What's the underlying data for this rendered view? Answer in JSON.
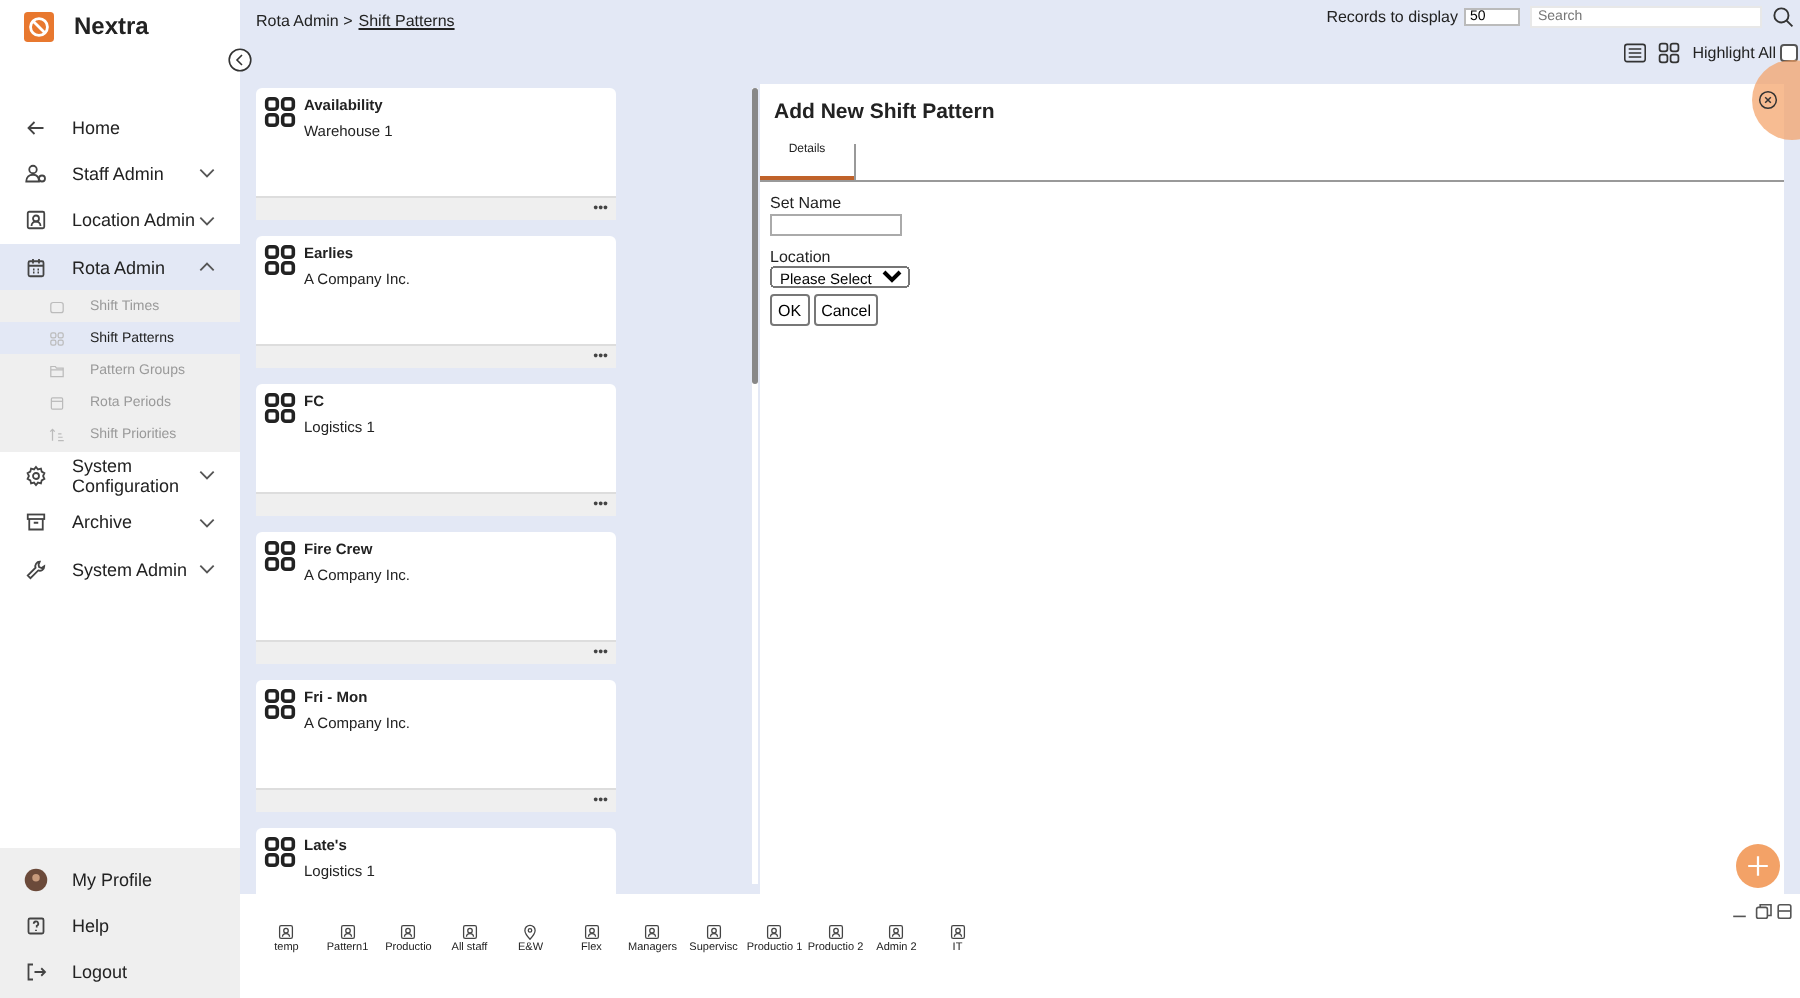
{
  "brand": {
    "name": "Nextra"
  },
  "sidebar": {
    "items": [
      {
        "label": "Home",
        "selected": false
      },
      {
        "label": "Staff Admin",
        "expanded": false,
        "selected": false
      },
      {
        "label": "Location Admin",
        "expanded": false,
        "selected": false
      },
      {
        "label": "Rota Admin",
        "expanded": true,
        "selected": true,
        "children": [
          {
            "label": "Shift Times",
            "selected": false
          },
          {
            "label": "Shift Patterns",
            "selected": true
          },
          {
            "label": "Pattern Groups",
            "selected": false
          },
          {
            "label": "Rota Periods",
            "selected": false
          },
          {
            "label": "Shift Priorities",
            "selected": false
          }
        ]
      },
      {
        "label": "System Configuration",
        "expanded": false,
        "selected": false
      },
      {
        "label": "Archive",
        "expanded": false,
        "selected": false
      },
      {
        "label": "System Admin",
        "expanded": false,
        "selected": false
      }
    ],
    "footer": [
      {
        "label": "My Profile"
      },
      {
        "label": "Help"
      },
      {
        "label": "Logout"
      }
    ]
  },
  "breadcrumb": {
    "parent": "Rota Admin >",
    "current": "Shift Patterns"
  },
  "toolbar": {
    "records_label": "Records to display",
    "records_value": "50",
    "search_placeholder": "Search",
    "highlight_label": "Highlight All",
    "highlight_checked": false
  },
  "patterns": [
    {
      "name": "Availability",
      "location": "Warehouse 1"
    },
    {
      "name": "Earlies",
      "location": "A Company Inc."
    },
    {
      "name": "FC",
      "location": "Logistics 1"
    },
    {
      "name": "Fire Crew",
      "location": "A Company Inc."
    },
    {
      "name": "Fri - Mon",
      "location": "A Company Inc."
    },
    {
      "name": "Late's",
      "location": "Logistics 1"
    }
  ],
  "card_menu": "•••",
  "panel": {
    "title": "Add New Shift Pattern",
    "tabs": [
      {
        "label": "Details",
        "selected": true
      }
    ],
    "set_name_label": "Set Name",
    "location_label": "Location",
    "location_value": "Please Select",
    "buttons": [
      "OK",
      "Cancel"
    ]
  },
  "taskbar": [
    {
      "label": "temp",
      "kind": "group"
    },
    {
      "label": "Pattern1",
      "kind": "group"
    },
    {
      "label": "Productio",
      "kind": "group"
    },
    {
      "label": "All staff",
      "kind": "group"
    },
    {
      "label": "E&W",
      "kind": "location"
    },
    {
      "label": "Flex",
      "kind": "group"
    },
    {
      "label": "Managers",
      "kind": "group"
    },
    {
      "label": "Supervisc",
      "kind": "group"
    },
    {
      "label": "Productio 1",
      "kind": "group"
    },
    {
      "label": "Productio 2",
      "kind": "group"
    },
    {
      "label": "Admin 2",
      "kind": "group"
    },
    {
      "label": "IT",
      "kind": "group"
    }
  ]
}
